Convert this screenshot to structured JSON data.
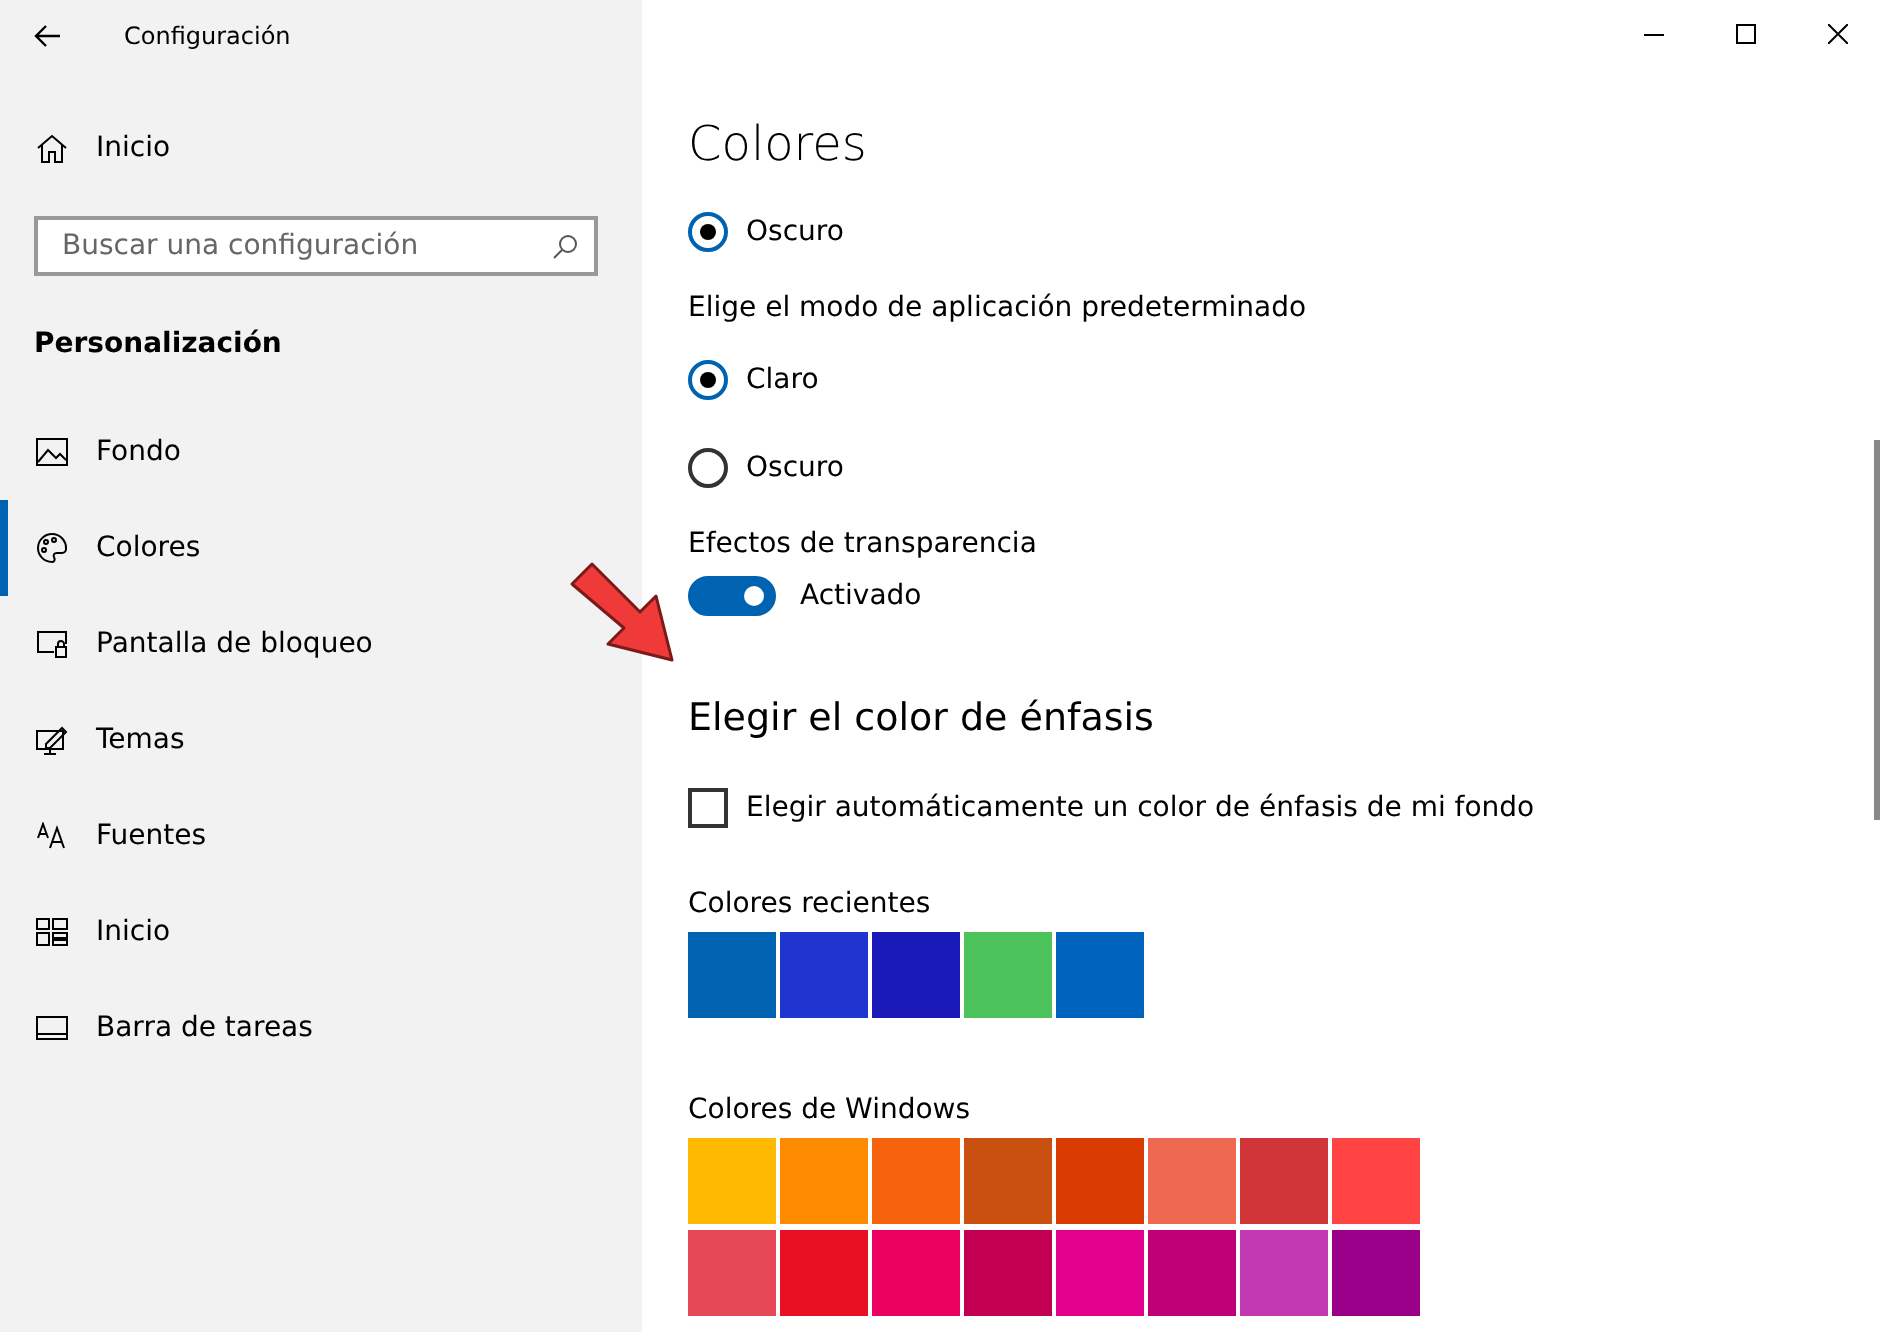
{
  "window": {
    "title": "Configuración"
  },
  "sidebar": {
    "home": "Inicio",
    "search": {
      "placeholder": "Buscar una configuración"
    },
    "section": "Personalización",
    "items": [
      {
        "label": "Fondo",
        "selected": false
      },
      {
        "label": "Colores",
        "selected": true
      },
      {
        "label": "Pantalla de bloqueo",
        "selected": false
      },
      {
        "label": "Temas",
        "selected": false
      },
      {
        "label": "Fuentes",
        "selected": false
      },
      {
        "label": "Inicio",
        "selected": false
      },
      {
        "label": "Barra de tareas",
        "selected": false
      }
    ]
  },
  "main": {
    "title": "Colores",
    "windows_mode": [
      {
        "label": "Oscuro",
        "selected": true
      }
    ],
    "app_mode": {
      "label": "Elige el modo de aplicación predeterminado",
      "options": [
        {
          "label": "Claro",
          "selected": true
        },
        {
          "label": "Oscuro",
          "selected": false
        }
      ]
    },
    "transparency": {
      "label": "Efectos de transparencia",
      "on": true,
      "state_text": "Activado"
    },
    "accent": {
      "heading": "Elegir el color de énfasis",
      "auto": {
        "label": "Elegir automáticamente un color de énfasis de mi fondo",
        "checked": false
      },
      "recent": {
        "label": "Colores recientes",
        "swatches": [
          {
            "color": "#0063b1"
          },
          {
            "color": "#2035d0"
          },
          {
            "color": "#1a1ab8"
          },
          {
            "color": "#4cc35a"
          },
          {
            "color": "#0063be"
          }
        ]
      },
      "windows": {
        "label": "Colores de Windows",
        "rows": [
          [
            {
              "color": "#ffb900"
            },
            {
              "color": "#ff8c00"
            },
            {
              "color": "#f7630c"
            },
            {
              "color": "#ca5010"
            },
            {
              "color": "#da3b01"
            },
            {
              "color": "#ef6950"
            },
            {
              "color": "#d13438"
            },
            {
              "color": "#ff4343"
            }
          ],
          [
            {
              "color": "#e74856"
            },
            {
              "color": "#e81123"
            },
            {
              "color": "#ea005e"
            },
            {
              "color": "#c30052"
            },
            {
              "color": "#e3008c"
            },
            {
              "color": "#bf0077"
            },
            {
              "color": "#c239b3"
            },
            {
              "color": "#9a0089"
            }
          ]
        ]
      }
    }
  }
}
